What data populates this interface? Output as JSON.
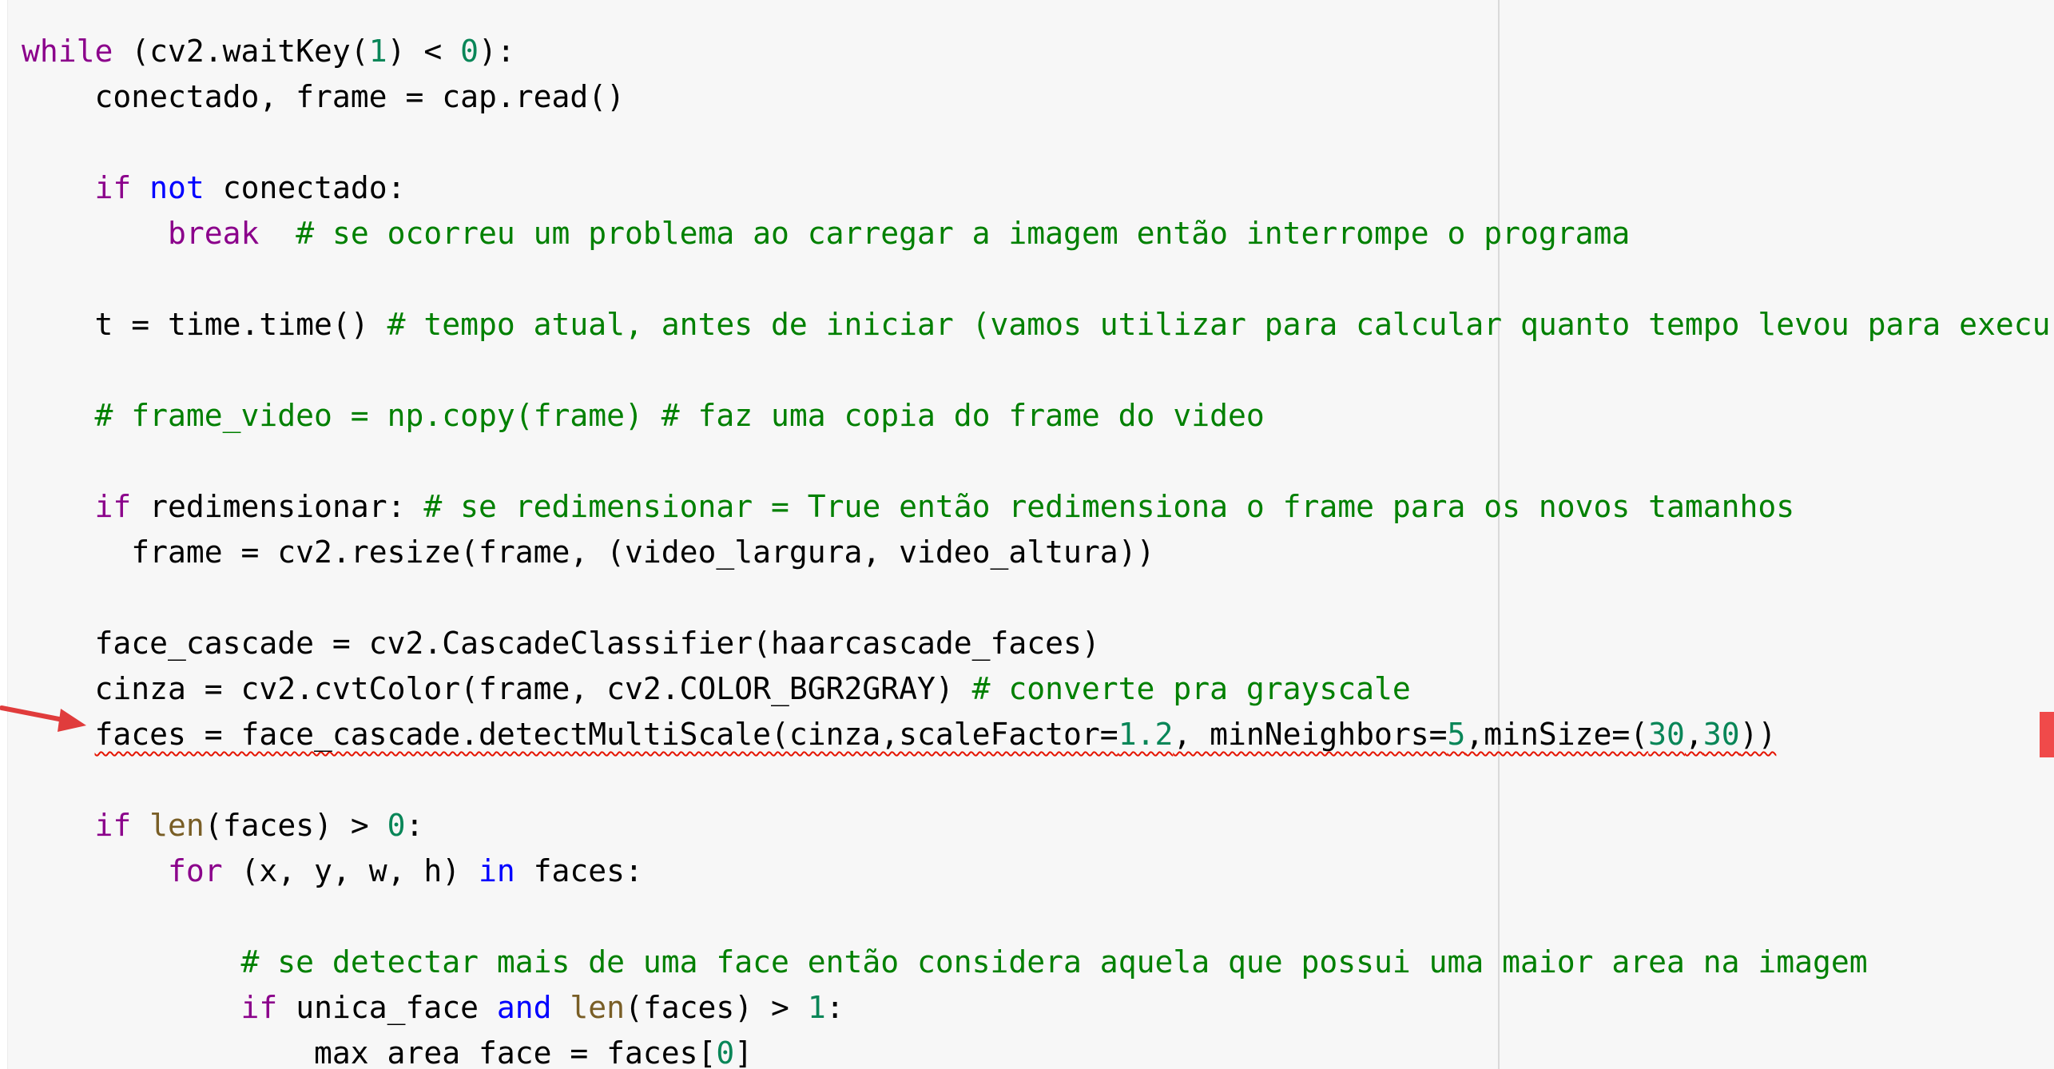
{
  "code": {
    "lines": [
      {
        "indent": "",
        "tokens": [
          {
            "t": "while",
            "c": "kw"
          },
          {
            "t": " (cv2.waitKey("
          },
          {
            "t": "1",
            "c": "num"
          },
          {
            "t": ") < "
          },
          {
            "t": "0",
            "c": "num"
          },
          {
            "t": "):"
          }
        ]
      },
      {
        "indent": "    ",
        "tokens": [
          {
            "t": "conectado, frame = cap.read()"
          }
        ]
      },
      {
        "indent": "",
        "tokens": []
      },
      {
        "indent": "    ",
        "tokens": [
          {
            "t": "if",
            "c": "kw"
          },
          {
            "t": " "
          },
          {
            "t": "not",
            "c": "kb"
          },
          {
            "t": " conectado:"
          }
        ]
      },
      {
        "indent": "        ",
        "tokens": [
          {
            "t": "break",
            "c": "kw"
          },
          {
            "t": "  "
          },
          {
            "t": "# se ocorreu um problema ao carregar a imagem então interrompe o programa",
            "c": "cm"
          }
        ]
      },
      {
        "indent": "",
        "tokens": []
      },
      {
        "indent": "    ",
        "tokens": [
          {
            "t": "t = time.time() "
          },
          {
            "t": "# tempo atual, antes de iniciar (vamos utilizar para calcular quanto tempo levou para execu",
            "c": "cm"
          }
        ]
      },
      {
        "indent": "",
        "tokens": []
      },
      {
        "indent": "    ",
        "tokens": [
          {
            "t": "# frame_video = np.copy(frame) # faz uma copia do frame do video",
            "c": "cm"
          }
        ]
      },
      {
        "indent": "",
        "tokens": []
      },
      {
        "indent": "    ",
        "tokens": [
          {
            "t": "if",
            "c": "kw"
          },
          {
            "t": " redimensionar: "
          },
          {
            "t": "# se redimensionar = True então redimensiona o frame para os novos tamanhos",
            "c": "cm"
          }
        ]
      },
      {
        "indent": "      ",
        "tokens": [
          {
            "t": "frame = cv2.resize(frame, (video_largura, video_altura))"
          }
        ]
      },
      {
        "indent": "",
        "tokens": []
      },
      {
        "indent": "    ",
        "tokens": [
          {
            "t": "face_cascade = cv2.CascadeClassifier(haarcascade_faces)"
          }
        ]
      },
      {
        "indent": "    ",
        "tokens": [
          {
            "t": "cinza = cv2.cvtColor(frame, cv2.COLOR_BGR2GRAY) "
          },
          {
            "t": "# converte pra grayscale",
            "c": "cm"
          }
        ]
      },
      {
        "indent": "    ",
        "error": true,
        "tokens": [
          {
            "t": "faces = face_cascade.detectMultiScale(cinza,scaleFactor="
          },
          {
            "t": "1.2",
            "c": "num"
          },
          {
            "t": ", minNeighbors="
          },
          {
            "t": "5",
            "c": "num"
          },
          {
            "t": ",minSize=("
          },
          {
            "t": "30",
            "c": "num"
          },
          {
            "t": ","
          },
          {
            "t": "30",
            "c": "num"
          },
          {
            "t": "))"
          }
        ]
      },
      {
        "indent": "",
        "tokens": []
      },
      {
        "indent": "    ",
        "tokens": [
          {
            "t": "if",
            "c": "kw"
          },
          {
            "t": " "
          },
          {
            "t": "len",
            "c": "fn"
          },
          {
            "t": "(faces) > "
          },
          {
            "t": "0",
            "c": "num"
          },
          {
            "t": ":"
          }
        ]
      },
      {
        "indent": "        ",
        "tokens": [
          {
            "t": "for",
            "c": "kw"
          },
          {
            "t": " (x, y, w, h) "
          },
          {
            "t": "in",
            "c": "kb"
          },
          {
            "t": " faces:"
          }
        ]
      },
      {
        "indent": "",
        "tokens": []
      },
      {
        "indent": "            ",
        "tokens": [
          {
            "t": "# se detectar mais de uma face então considera aquela que possui uma maior area na imagem",
            "c": "cm"
          }
        ]
      },
      {
        "indent": "            ",
        "tokens": [
          {
            "t": "if",
            "c": "kw"
          },
          {
            "t": " unica_face "
          },
          {
            "t": "and",
            "c": "kb"
          },
          {
            "t": " "
          },
          {
            "t": "len",
            "c": "fn"
          },
          {
            "t": "(faces) > "
          },
          {
            "t": "1",
            "c": "num"
          },
          {
            "t": ":"
          }
        ]
      },
      {
        "indent": "                ",
        "tokens": [
          {
            "t": "max_area_face = faces["
          },
          {
            "t": "0",
            "c": "num"
          },
          {
            "t": "]"
          }
        ]
      }
    ]
  },
  "colors": {
    "background": "#f7f7f7",
    "keyword": "#8b008b",
    "keyword_blue": "#0000ff",
    "builtin": "#795e26",
    "number": "#098658",
    "comment": "#008000",
    "error_squiggle": "#e51400",
    "annotation_arrow": "#e03c3c"
  },
  "icons": {
    "annotation": "red-arrow-icon",
    "error_marker": "scrollbar-error-marker"
  }
}
